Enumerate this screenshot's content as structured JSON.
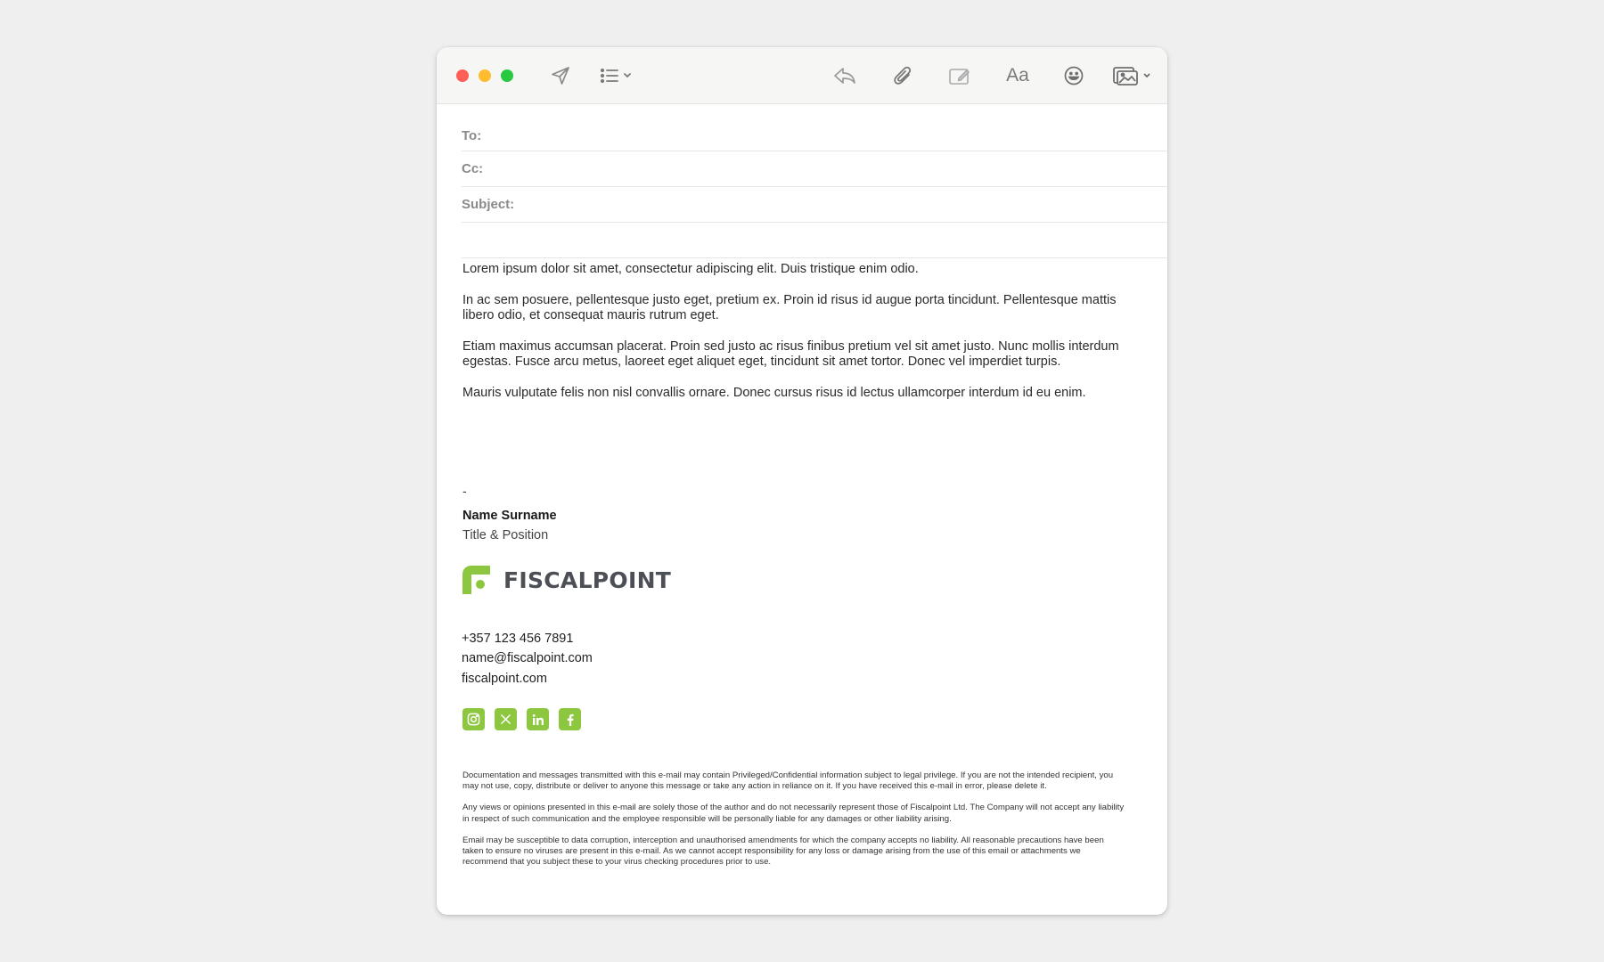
{
  "toolbar": {
    "icons": [
      "send-icon",
      "list-format-icon",
      "reply-icon",
      "attachment-icon",
      "markup-icon",
      "font-icon",
      "emoji-icon",
      "photo-browser-icon"
    ],
    "font_label": "Aa"
  },
  "header_fields": {
    "to_label": "To:",
    "cc_label": "Cc:",
    "subject_label": "Subject:"
  },
  "body": {
    "paragraphs": [
      "Lorem ipsum dolor sit amet, consectetur adipiscing elit. Duis tristique enim odio.",
      "In ac sem posuere, pellentesque justo eget, pretium ex. Proin id risus id augue porta tincidunt. Pellentesque mattis libero odio, et consequat mauris rutrum eget.",
      "Etiam maximus accumsan placerat. Proin sed justo ac risus finibus pretium vel sit amet justo. Nunc mollis interdum egestas. Fusce arcu metus, laoreet eget aliquet eget, tincidunt sit amet tortor. Donec vel imperdiet turpis.",
      "Mauris vulputate felis non nisl convallis ornare. Donec cursus risus id lectus ullamcorper interdum id eu enim."
    ]
  },
  "signature": {
    "dash": "-",
    "name": "Name Surname",
    "title": "Title & Position",
    "company": "FISCALPOINT",
    "phone": "+357 123 456 7891",
    "email": "name@fiscalpoint.com",
    "website": "fiscalpoint.com",
    "social_icons": [
      "instagram-icon",
      "x-icon",
      "linkedin-icon",
      "facebook-icon"
    ],
    "brand_color": "#8dc63f"
  },
  "disclaimer": [
    "Documentation and messages transmitted with this e-mail may contain Privileged/Confidential information subject to legal privilege. If you are not the intended recipient, you may not use, copy, distribute or deliver to anyone this message or take any action in reliance on it. If you have received this e-mail in error, please delete it.",
    "Any views or opinions presented in this e-mail are solely those of the author and do not necessarily represent those of Fiscalpoint Ltd. The Company will not accept any liability in respect of such communication and the employee responsible will be personally liable for any damages or other liability arising.",
    "Email may be susceptible to data corruption, interception and unauthorised amendments for which the company accepts no liability. All reasonable precautions have been taken to ensure no viruses are present in this e-mail. As we cannot accept responsibility for any loss or damage arising from the use of this email or attachments we recommend that you subject these to your virus checking procedures prior to use."
  ]
}
